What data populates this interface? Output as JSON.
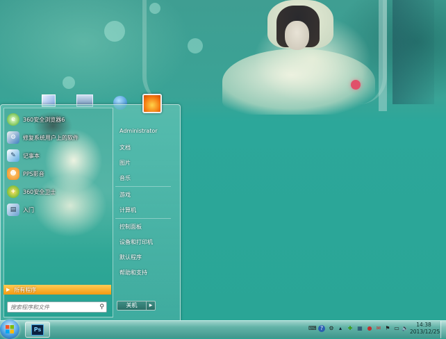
{
  "start_menu": {
    "pinned_programs": [
      {
        "label": "360安全浏览器6",
        "icon": "360-browser-icon",
        "color": "#5ab82a"
      },
      {
        "label": "修复系统用户上的软件",
        "icon": "tool-icon",
        "color": "#3f7fc0"
      },
      {
        "label": "记事本",
        "icon": "notepad-icon",
        "color": "#5aa8e0"
      },
      {
        "label": "PPS影音",
        "icon": "pps-icon",
        "color": "#f08a18"
      },
      {
        "label": "360安全卫士",
        "icon": "360-safe-icon",
        "color": "#4bb02a"
      },
      {
        "label": "入门",
        "icon": "getting-started-icon",
        "color": "#6aa0d0"
      }
    ],
    "all_programs_label": "所有程序",
    "search_placeholder": "搜索程序和文件",
    "right_column": {
      "user_name": "Administrator",
      "items": [
        "文档",
        "图片",
        "音乐",
        "游戏",
        "计算机",
        "控制面板",
        "设备和打印机",
        "默认程序",
        "帮助和支持"
      ]
    },
    "shutdown_label": "关机"
  },
  "taskbar": {
    "pinned_app_label": "Ps",
    "clock_time": "14:38",
    "clock_date": "2013/12/25"
  },
  "colors": {
    "accent_orange": "#f39a12",
    "desktop_teal": "#2aa596"
  }
}
